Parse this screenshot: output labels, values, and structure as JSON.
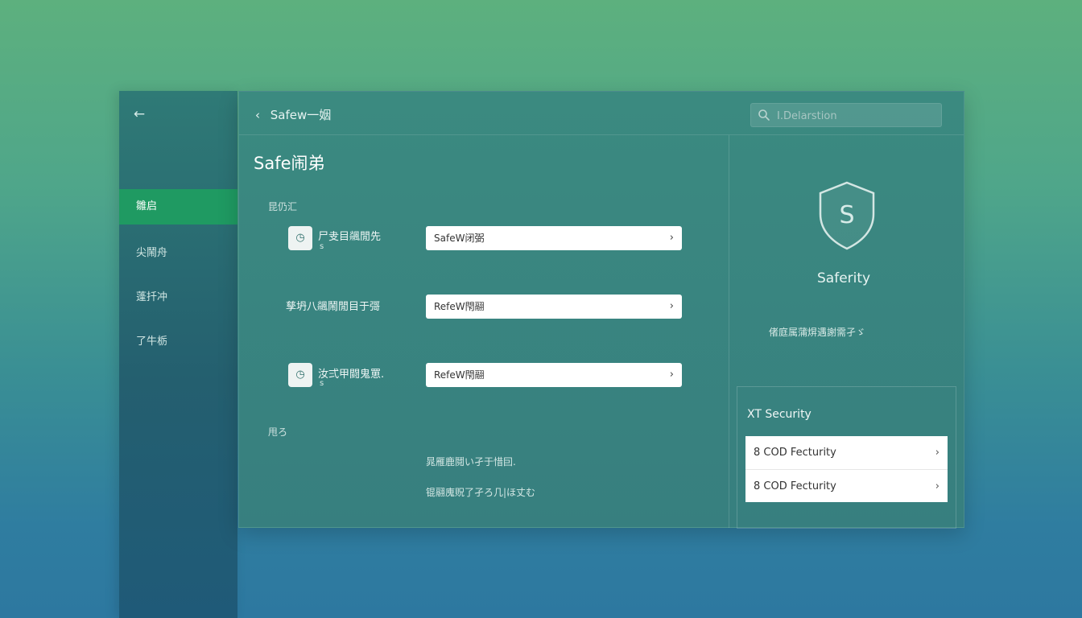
{
  "sidebar": {
    "back_icon": "arrow-left-icon",
    "items": [
      {
        "label": "雛启",
        "active": true
      },
      {
        "label": "尖鬧舟"
      },
      {
        "label": "蓬扦冲"
      },
      {
        "label": "了牛栃"
      }
    ]
  },
  "header": {
    "breadcrumb": "Safew一姻",
    "search_placeholder": "I.Delarstion"
  },
  "main": {
    "title": "Safe闹弟",
    "section1_label": "昆仍汇",
    "rows": [
      {
        "label": "尸叏目飊閒先",
        "sub": "s",
        "button": "SafeW闭弼",
        "has_icon": true
      },
      {
        "label": "孳坍八飊鬧閒目于彁",
        "sub": "",
        "button": "RefeW閇翮",
        "has_icon": false
      },
      {
        "label": "汝弍甲闘鬼罳.",
        "sub": "s",
        "button": "RefeW閇翮",
        "has_icon": true
      }
    ],
    "section2_label": "甩ろ",
    "notes": [
      "晁雁鹿鬩い孑于惜囙.",
      "锟翮廆贶了孑ろ几|ほ丈む"
    ]
  },
  "right": {
    "shield_letter": "S",
    "title": "Saferity",
    "description": "偖庭属蒲焺遇謝需孑ゞ",
    "security": {
      "title": "XT Security",
      "items": [
        {
          "label": "8 COD Fecturity"
        },
        {
          "label": "8 COD Fecturity"
        }
      ]
    }
  },
  "colors": {
    "accent": "#1f9a62",
    "panel": "#3b8a80",
    "sidebar": "#245f6f"
  }
}
